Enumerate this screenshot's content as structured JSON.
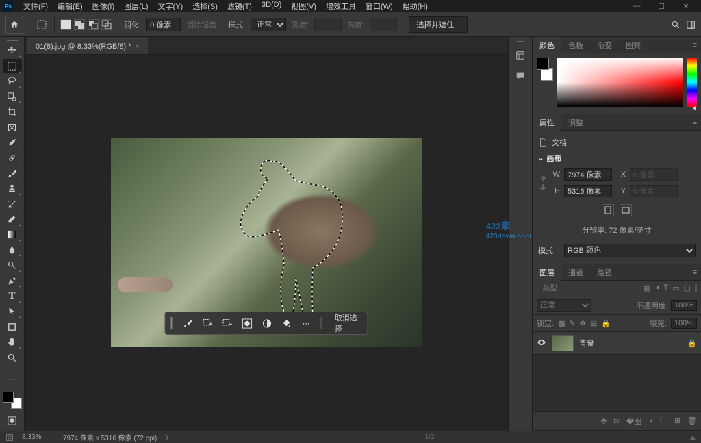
{
  "menu": {
    "file": "文件(F)",
    "edit": "编辑(E)",
    "image": "图像(I)",
    "layer": "图层(L)",
    "type": "文字(Y)",
    "select": "选择(S)",
    "filter": "滤镜(T)",
    "threeD": "3D(D)",
    "view": "视图(V)",
    "plugins": "增效工具",
    "window": "窗口(W)",
    "help": "帮助(H)"
  },
  "options": {
    "feather_label": "羽化:",
    "feather_value": "0 像素",
    "antialias": "消除锯齿",
    "style_label": "样式:",
    "style_value": "正常",
    "width_label": "宽度:",
    "height_label": "高度:",
    "select_mask": "选择并遮住..."
  },
  "document": {
    "tab_title": "01(8).jpg @ 8.33%(RGB/8) *"
  },
  "action_bar": {
    "deselect": "取消选择"
  },
  "panels": {
    "color": {
      "tab_color": "颜色",
      "tab_swatches": "色板",
      "tab_gradients": "渐变",
      "tab_patterns": "图案"
    },
    "properties": {
      "tab_properties": "属性",
      "tab_adjust": "调整",
      "doc_label": "文档",
      "canvas_section": "画布",
      "w_label": "W",
      "w_value": "7974 像素",
      "x_label": "X",
      "x_value": "0 像素",
      "h_label": "H",
      "h_value": "5316 像素",
      "y_label": "Y",
      "y_value": "0 像素",
      "resolution": "分辨率: 72 像素/英寸",
      "mode_label": "模式",
      "mode_value": "RGB 颜色"
    },
    "layers": {
      "tab_layers": "图层",
      "tab_channels": "通道",
      "tab_paths": "路径",
      "search_placeholder": "类型",
      "blend_mode": "正常",
      "opacity_label": "不透明度:",
      "opacity_value": "100%",
      "lock_label": "锁定:",
      "fill_label": "填充:",
      "fill_value": "100%",
      "bg_layer": "背景"
    }
  },
  "status": {
    "zoom": "8.33%",
    "dims": "7974 像素 x 5316 像素 (72 ppi)",
    "page": "1/2"
  },
  "watermark": {
    "brand": "423",
    "domain": "423down.com"
  }
}
